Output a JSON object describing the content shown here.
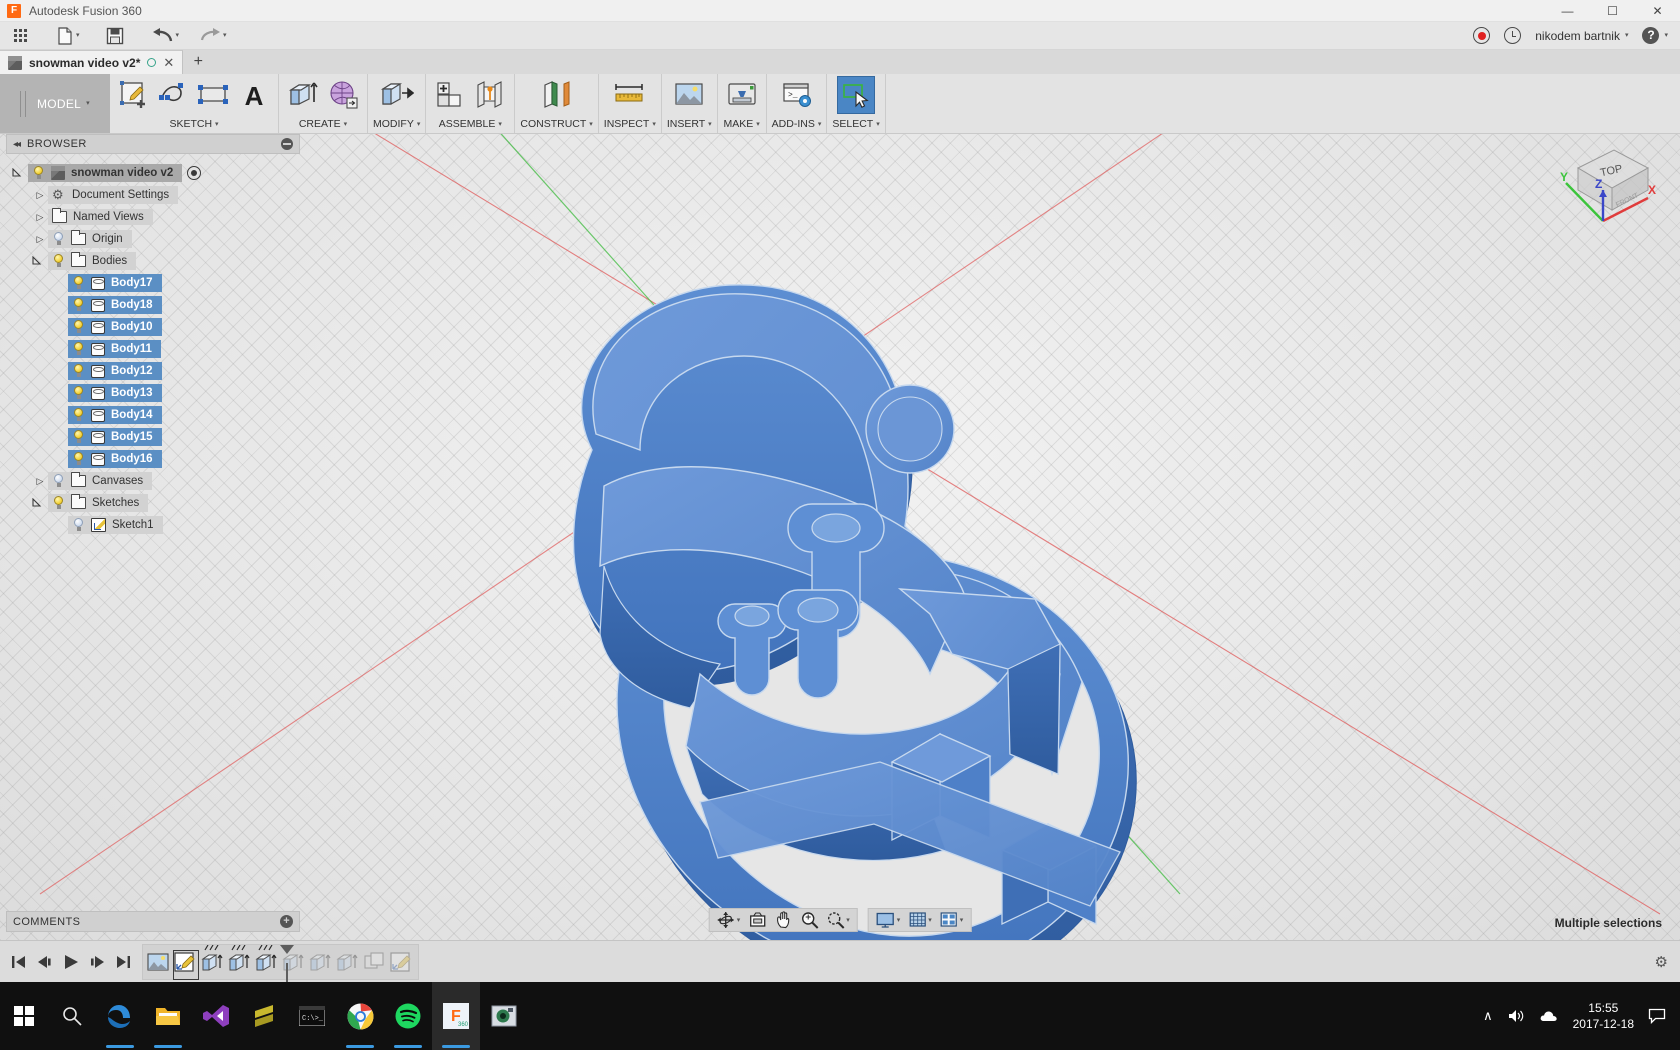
{
  "window": {
    "app_title": "Autodesk Fusion 360",
    "logo_letter": "F",
    "minimize": "—",
    "maximize": "☐",
    "close": "✕"
  },
  "quick_access": {
    "show_data_panel_icon": "grid-icon",
    "new_icon": "new-document-icon",
    "save_icon": "save-icon",
    "undo_icon": "undo-icon",
    "redo_icon": "redo-icon",
    "caret": "▾",
    "job_status_icon": "record-icon",
    "history_icon": "clock-icon",
    "user_name": "nikodem bartnik",
    "help_label": "?"
  },
  "tabs": {
    "document_title": "snowman video v2*",
    "save_indicator": "unsaved-circle",
    "close_label": "✕",
    "new_tab_label": "+"
  },
  "ribbon": {
    "workspace": "MODEL",
    "workspace_caret": "▾",
    "groups": [
      {
        "label": "SKETCH",
        "caret": "▾",
        "tools": [
          "create-sketch-icon",
          "spline-icon",
          "rectangle-icon",
          "text-icon"
        ]
      },
      {
        "label": "CREATE",
        "caret": "▾",
        "tools": [
          "extrude-icon",
          "create-form-icon"
        ]
      },
      {
        "label": "MODIFY",
        "caret": "▾",
        "tools": [
          "press-pull-icon"
        ]
      },
      {
        "label": "ASSEMBLE",
        "caret": "▾",
        "tools": [
          "new-component-icon",
          "joint-icon"
        ]
      },
      {
        "label": "CONSTRUCT",
        "caret": "▾",
        "tools": [
          "offset-plane-icon"
        ]
      },
      {
        "label": "INSPECT",
        "caret": "▾",
        "tools": [
          "measure-icon"
        ]
      },
      {
        "label": "INSERT",
        "caret": "▾",
        "tools": [
          "insert-canvas-icon"
        ]
      },
      {
        "label": "MAKE",
        "caret": "▾",
        "tools": [
          "3d-print-icon"
        ]
      },
      {
        "label": "ADD-INS",
        "caret": "▾",
        "tools": [
          "scripts-addins-icon"
        ]
      },
      {
        "label": "SELECT",
        "caret": "▾",
        "tools": [
          "select-window-icon"
        ],
        "active": true
      }
    ]
  },
  "browser": {
    "header_title": "BROWSER",
    "collapse_icon": "collapse-left-icon",
    "options_icon": "minus-circle-icon",
    "tree": [
      {
        "label": "snowman video v2",
        "icon": "component-cube-icon",
        "twisty": "expanded",
        "bulb": "on",
        "root": true,
        "activate_icon": "activate-component-icon"
      },
      {
        "label": "Document Settings",
        "icon": "gear-icon",
        "twisty": "collapsed",
        "bulb": "none",
        "indent": 1
      },
      {
        "label": "Named Views",
        "icon": "folder-icon",
        "twisty": "collapsed",
        "bulb": "none",
        "indent": 1
      },
      {
        "label": "Origin",
        "icon": "folder-icon",
        "twisty": "collapsed",
        "bulb": "off",
        "indent": 1
      },
      {
        "label": "Bodies",
        "icon": "folder-icon",
        "twisty": "expanded",
        "bulb": "on",
        "indent": 1
      },
      {
        "label": "Body17",
        "icon": "body-icon",
        "twisty": "none",
        "bulb": "on",
        "indent": 2,
        "selected": true
      },
      {
        "label": "Body18",
        "icon": "body-icon",
        "twisty": "none",
        "bulb": "on",
        "indent": 2,
        "selected": true
      },
      {
        "label": "Body10",
        "icon": "body-icon",
        "twisty": "none",
        "bulb": "on",
        "indent": 2,
        "selected": true
      },
      {
        "label": "Body11",
        "icon": "body-icon",
        "twisty": "none",
        "bulb": "on",
        "indent": 2,
        "selected": true
      },
      {
        "label": "Body12",
        "icon": "body-icon",
        "twisty": "none",
        "bulb": "on",
        "indent": 2,
        "selected": true
      },
      {
        "label": "Body13",
        "icon": "body-icon",
        "twisty": "none",
        "bulb": "on",
        "indent": 2,
        "selected": true
      },
      {
        "label": "Body14",
        "icon": "body-icon",
        "twisty": "none",
        "bulb": "on",
        "indent": 2,
        "selected": true
      },
      {
        "label": "Body15",
        "icon": "body-icon",
        "twisty": "none",
        "bulb": "on",
        "indent": 2,
        "selected": true
      },
      {
        "label": "Body16",
        "icon": "body-icon",
        "twisty": "none",
        "bulb": "on",
        "indent": 2,
        "selected": true
      },
      {
        "label": "Canvases",
        "icon": "folder-icon",
        "twisty": "collapsed",
        "bulb": "off",
        "indent": 1
      },
      {
        "label": "Sketches",
        "icon": "folder-icon",
        "twisty": "expanded",
        "bulb": "on",
        "indent": 1
      },
      {
        "label": "Sketch1",
        "icon": "sketch-icon",
        "twisty": "none",
        "bulb": "off",
        "indent": 2
      }
    ]
  },
  "comments": {
    "label": "COMMENTS",
    "add_icon": "plus-circle-icon"
  },
  "status": {
    "selection_text": "Multiple selections"
  },
  "navbar": {
    "buttons": [
      {
        "name": "orbit-icon",
        "caret": "▾"
      },
      {
        "name": "look-at-icon",
        "caret": ""
      },
      {
        "name": "pan-icon",
        "caret": ""
      },
      {
        "name": "zoom-icon",
        "caret": ""
      },
      {
        "name": "zoom-window-icon",
        "caret": "▾"
      }
    ],
    "display_buttons": [
      {
        "name": "display-settings-icon",
        "caret": "▾"
      },
      {
        "name": "grid-snaps-icon",
        "caret": "▾"
      },
      {
        "name": "viewports-icon",
        "caret": "▾"
      }
    ]
  },
  "viewcube": {
    "top_face_label": "TOP",
    "front_face_label": "FRONT",
    "axis_x": "X",
    "axis_y": "Y",
    "axis_z": "Z",
    "color_x": "#e03c3c",
    "color_y": "#3cc43c",
    "color_z": "#3a46c8"
  },
  "timeline": {
    "playback": [
      "go-to-beginning-icon",
      "step-back-icon",
      "play-icon",
      "step-forward-icon",
      "go-to-end-icon"
    ],
    "features": [
      {
        "name": "canvas-feature-icon",
        "state": "active"
      },
      {
        "name": "sketch-feature-icon",
        "state": "selected"
      },
      {
        "name": "extrude-feature-icon",
        "state": "active"
      },
      {
        "name": "extrude-feature-icon",
        "state": "active"
      },
      {
        "name": "extrude-feature-icon",
        "state": "active"
      },
      {
        "name": "extrude-feature-icon",
        "state": "rolled-back"
      },
      {
        "name": "extrude-feature-icon",
        "state": "rolled-back"
      },
      {
        "name": "extrude-feature-icon",
        "state": "rolled-back"
      },
      {
        "name": "combine-feature-icon",
        "state": "rolled-back"
      },
      {
        "name": "sketch-feature-icon",
        "state": "rolled-back"
      }
    ],
    "settings_icon": "gear-icon"
  },
  "taskbar": {
    "items": [
      "windows-start-icon",
      "search-icon",
      "edge-icon",
      "file-explorer-icon",
      "visual-studio-icon",
      "sublime-text-icon",
      "command-prompt-icon",
      "chrome-icon",
      "spotify-icon",
      "fusion360-icon",
      "photos-icon"
    ],
    "tray": {
      "chevron_up_icon": "∧",
      "volume_icon": "volume-icon",
      "onedrive_icon": "cloud-icon",
      "time": "15:55",
      "date": "2017-12-18",
      "action_center_icon": "notification-icon"
    }
  },
  "model": {
    "color_body": "#4a7fc8",
    "color_body_light": "#6a98d6",
    "color_body_dark": "#3a6cb0",
    "edge_color": "#c6d8ee",
    "description": "snowman cookie cutter 3d model"
  }
}
